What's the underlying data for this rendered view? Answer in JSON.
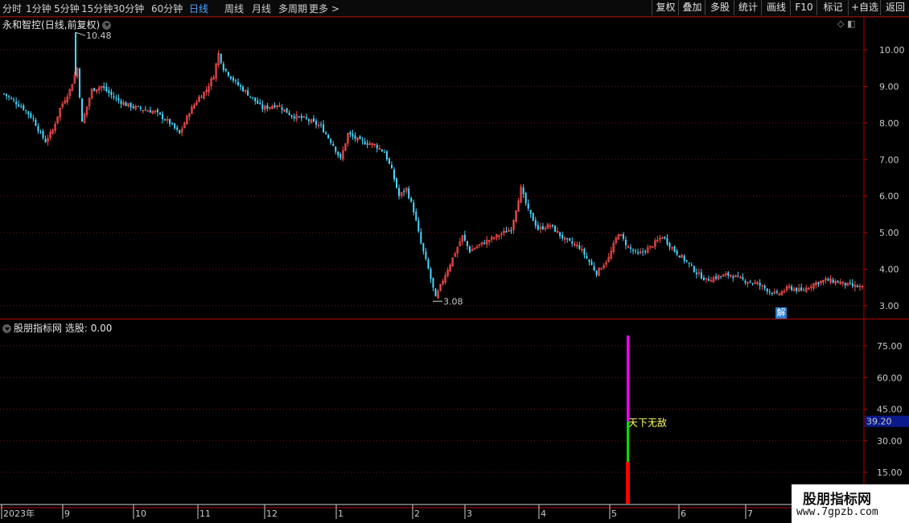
{
  "toolbar": {
    "periods": [
      "分时",
      "1分钟",
      "5分钟",
      "15分钟",
      "30分钟",
      "60分钟",
      "日线",
      "周线",
      "月线",
      "多周期",
      "更多 >"
    ],
    "active_period": "日线",
    "right_buttons": [
      "复权",
      "叠加",
      "多股",
      "统计",
      "画线",
      "F10",
      "标记",
      "+自选",
      "返回"
    ]
  },
  "main_chart": {
    "stock_name": "永和智控",
    "mode": "(日线,前复权)",
    "y_axis_ticks": [
      "10.00",
      "9.00",
      "8.00",
      "7.00",
      "6.00",
      "5.00",
      "4.00",
      "3.00"
    ],
    "high_annotation": "10.48",
    "low_annotation": "3.08",
    "badge": "解"
  },
  "indicator": {
    "name": "股朋指标网",
    "value_label": "选股: 0.00",
    "y_axis_ticks": [
      "75.00",
      "60.00",
      "45.00",
      "30.00",
      "15.00"
    ],
    "current_value": "39.20",
    "signal_text": "天下无敌"
  },
  "date_axis": [
    "2023年",
    "9",
    "10",
    "11",
    "12",
    "1",
    "2",
    "3",
    "4",
    "5",
    "6",
    "7"
  ],
  "watermark": {
    "title": "股朋指标网",
    "url": "www.7gpzb.com"
  },
  "colors": {
    "up": "#ff4d4d",
    "down": "#4ad8ff",
    "grid": "#7a1010",
    "border": "#b00000",
    "magenta": "#ff00ff",
    "green": "#00e000",
    "red": "#ff0000",
    "signal": "#ffff66",
    "active": "#4fa3ff"
  },
  "chart_data": {
    "type": "candlestick",
    "y_range": [
      2.8,
      10.7
    ],
    "price_path": [
      [
        0,
        8.8
      ],
      [
        4,
        8.6
      ],
      [
        8,
        8.4
      ],
      [
        12,
        8.1
      ],
      [
        15,
        7.7
      ],
      [
        17,
        7.5
      ],
      [
        20,
        7.8
      ],
      [
        23,
        8.4
      ],
      [
        27,
        8.9
      ],
      [
        30,
        9.5
      ],
      [
        32,
        8.0
      ],
      [
        36,
        8.9
      ],
      [
        40,
        9.0
      ],
      [
        45,
        8.7
      ],
      [
        50,
        8.5
      ],
      [
        55,
        8.4
      ],
      [
        62,
        8.3
      ],
      [
        68,
        8.0
      ],
      [
        72,
        7.7
      ],
      [
        76,
        8.3
      ],
      [
        80,
        8.7
      ],
      [
        83,
        8.9
      ],
      [
        86,
        9.3
      ],
      [
        88,
        9.9
      ],
      [
        90,
        9.5
      ],
      [
        95,
        9.1
      ],
      [
        100,
        8.8
      ],
      [
        106,
        8.4
      ],
      [
        112,
        8.5
      ],
      [
        118,
        8.2
      ],
      [
        124,
        8.1
      ],
      [
        130,
        7.9
      ],
      [
        135,
        7.4
      ],
      [
        138,
        7.0
      ],
      [
        141,
        7.7
      ],
      [
        146,
        7.5
      ],
      [
        152,
        7.4
      ],
      [
        156,
        7.2
      ],
      [
        159,
        6.7
      ],
      [
        162,
        6.0
      ],
      [
        165,
        6.2
      ],
      [
        168,
        5.6
      ],
      [
        171,
        4.7
      ],
      [
        174,
        4.0
      ],
      [
        177,
        3.2
      ],
      [
        180,
        3.7
      ],
      [
        184,
        4.3
      ],
      [
        188,
        4.9
      ],
      [
        191,
        4.5
      ],
      [
        196,
        4.7
      ],
      [
        202,
        4.9
      ],
      [
        208,
        5.1
      ],
      [
        212,
        6.2
      ],
      [
        215,
        5.6
      ],
      [
        219,
        5.1
      ],
      [
        224,
        5.2
      ],
      [
        230,
        4.8
      ],
      [
        236,
        4.6
      ],
      [
        240,
        4.2
      ],
      [
        243,
        3.9
      ],
      [
        248,
        4.3
      ],
      [
        252,
        5.0
      ],
      [
        256,
        4.6
      ],
      [
        260,
        4.4
      ],
      [
        265,
        4.6
      ],
      [
        270,
        4.9
      ],
      [
        275,
        4.5
      ],
      [
        280,
        4.2
      ],
      [
        284,
        3.9
      ],
      [
        288,
        3.7
      ],
      [
        293,
        3.8
      ],
      [
        298,
        3.85
      ],
      [
        303,
        3.7
      ],
      [
        309,
        3.6
      ],
      [
        314,
        3.4
      ],
      [
        317,
        3.3
      ],
      [
        322,
        3.5
      ],
      [
        327,
        3.4
      ],
      [
        332,
        3.6
      ],
      [
        337,
        3.7
      ],
      [
        342,
        3.65
      ],
      [
        347,
        3.55
      ],
      [
        352,
        3.5
      ]
    ],
    "candle_count": 353,
    "indicator_bar": {
      "total_top": 80,
      "segments": [
        {
          "color": "red",
          "from": 0,
          "to": 20
        },
        {
          "color": "green",
          "from": 20,
          "to": 39.2
        },
        {
          "color": "magenta",
          "from": 39.2,
          "to": 80
        }
      ],
      "x_index": 257
    }
  }
}
